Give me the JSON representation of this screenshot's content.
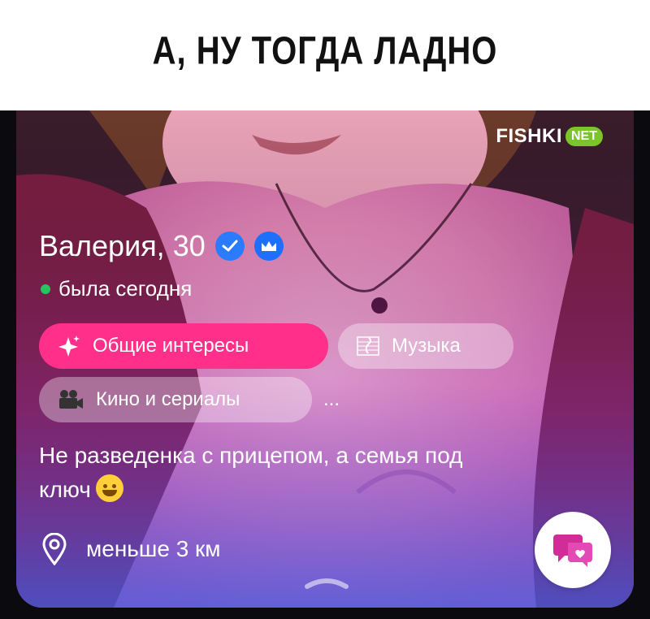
{
  "caption": {
    "text": "А, НУ ТОГДА ЛАДНО"
  },
  "brand": {
    "name": "FISHKI",
    "tld": "NET"
  },
  "profile": {
    "name_age": "Валерия, 30",
    "status": "была сегодня",
    "chips": [
      {
        "label": "Общие интересы",
        "icon": "sparkles-icon"
      },
      {
        "label": "Музыка",
        "icon": "music-icon"
      },
      {
        "label": "Кино и сериалы",
        "icon": "movie-camera-icon"
      }
    ],
    "more": "...",
    "bio_line1": "Не разведенка с прицепом, а семья под",
    "bio_line2": "ключ",
    "distance": "меньше 3 км"
  },
  "colors": {
    "chip_primary": "#ff2f8a",
    "online_dot": "#26c25d",
    "verified": "#2b7bff",
    "brand_pill": "#7bc42b"
  }
}
